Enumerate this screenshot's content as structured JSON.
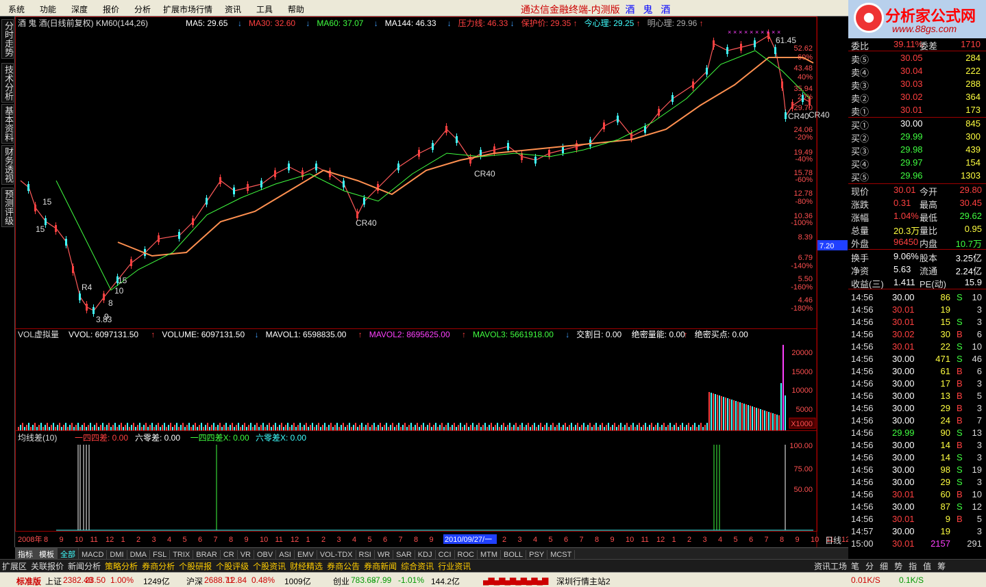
{
  "menu": [
    "系统",
    "功能",
    "深度",
    "报价",
    "分析",
    "扩展市场行情",
    "资讯",
    "工具",
    "帮助"
  ],
  "app_title": "通达信金融终端-内测版",
  "stock_title": "酒 鬼 酒",
  "logo": {
    "text": "分析家公式网",
    "url": "www.88gs.com"
  },
  "side_tabs": [
    "分时走势",
    "技术分析",
    "基本资料",
    "财务透视",
    "预测评级"
  ],
  "main_header": {
    "name": "酒 鬼 酒(日线前复权) KM60(144,26)",
    "items": [
      {
        "label": "MA5: 29.65",
        "color": "#ffffff",
        "arrow": "↓"
      },
      {
        "label": "MA30: 32.60",
        "color": "#ff4040",
        "arrow": "↓"
      },
      {
        "label": "MA60: 37.07",
        "color": "#40ff40",
        "arrow": "↓"
      },
      {
        "label": "MA144: 46.33",
        "color": "#ffffff",
        "arrow": "↓"
      },
      {
        "label": "压力线: 46.33",
        "color": "#ff4040",
        "arrow": "↓"
      },
      {
        "label": "保护价: 29.35",
        "color": "#ff4040",
        "arrow": "↑"
      },
      {
        "label": "今心理: 29.25",
        "color": "#40ffff",
        "arrow": "↑"
      },
      {
        "label": "明心理: 29.96",
        "color": "#aaaaaa",
        "arrow": "↑"
      }
    ]
  },
  "price_axis": [
    "52.62",
    "60%",
    "43.48",
    "40%",
    "35.94",
    "20%",
    "29.70",
    "24.06",
    "-20%",
    "19.49",
    "-40%",
    "15.78",
    "-60%",
    "12.78",
    "-80%",
    "10.36",
    "-100%",
    "8.39",
    "7.20",
    "6.79",
    "-140%",
    "5.50",
    "-160%",
    "4.46",
    "-180%"
  ],
  "price_annotations": [
    "61.45",
    "CR40",
    "CR40",
    "CR40",
    "CR40",
    "3.83",
    "10",
    "15",
    "15",
    "15",
    "R4",
    "8",
    "9"
  ],
  "vol_header": {
    "name": "VOL虚拟量",
    "items": [
      {
        "label": "VVOL: 6097131.50",
        "color": "#ffffff",
        "arrow": "↑"
      },
      {
        "label": "VOLUME: 6097131.50",
        "color": "#ffffff",
        "arrow": "↓"
      },
      {
        "label": "MAVOL1: 6598835.00",
        "color": "#ffffff",
        "arrow": "↑"
      },
      {
        "label": "MAVOL2: 8695625.00",
        "color": "#ff40ff",
        "arrow": "↑"
      },
      {
        "label": "MAVOL3: 5661918.00",
        "color": "#40ff40",
        "arrow": "↓"
      },
      {
        "label": "交割日: 0.00",
        "color": "#ffffff",
        "arrow": ""
      },
      {
        "label": "绝密量能: 0.00",
        "color": "#ffffff",
        "arrow": "↑"
      },
      {
        "label": "绝密买点: 0.00",
        "color": "#ffffff",
        "arrow": ""
      }
    ]
  },
  "vol_axis": [
    "20000",
    "15000",
    "10000",
    "5000",
    "X1000"
  ],
  "ind_header": {
    "name": "均线差(10)",
    "items": [
      {
        "label": "一四四差: 0.00",
        "color": "#ff4040"
      },
      {
        "label": "六零差: 0.00",
        "color": "#ffffff"
      },
      {
        "label": "一四四差X: 0.00",
        "color": "#40ff40"
      },
      {
        "label": "六零差X: 0.00",
        "color": "#40ffff"
      }
    ]
  },
  "ind_axis": [
    "100.00",
    "75.00",
    "50.00"
  ],
  "date_axis": [
    "2008年",
    "8",
    "9",
    "10",
    "11",
    "12",
    "1",
    "2",
    "3",
    "4",
    "5",
    "6",
    "7",
    "8",
    "9",
    "10",
    "11",
    "12",
    "1",
    "2",
    "3",
    "4",
    "5",
    "6",
    "7",
    "8",
    "9",
    "2010/09/27/一",
    "2",
    "3",
    "4",
    "5",
    "6",
    "7",
    "8",
    "9",
    "10",
    "11",
    "12",
    "1",
    "2",
    "3",
    "4",
    "5",
    "6",
    "7",
    "8",
    "9",
    "10",
    "11",
    "12",
    "1"
  ],
  "period_label": "日线",
  "quote": {
    "weibi": {
      "label": "委比",
      "value": "39.11%",
      "label2": "委差",
      "value2": "1710"
    },
    "sells": [
      {
        "label": "卖⑤",
        "price": "30.05",
        "vol": "284"
      },
      {
        "label": "卖④",
        "price": "30.04",
        "vol": "222"
      },
      {
        "label": "卖③",
        "price": "30.03",
        "vol": "288"
      },
      {
        "label": "卖②",
        "price": "30.02",
        "vol": "364"
      },
      {
        "label": "卖①",
        "price": "30.01",
        "vol": "173"
      }
    ],
    "buys": [
      {
        "label": "买①",
        "price": "30.00",
        "vol": "845"
      },
      {
        "label": "买②",
        "price": "29.99",
        "vol": "300"
      },
      {
        "label": "买③",
        "price": "29.98",
        "vol": "439"
      },
      {
        "label": "买④",
        "price": "29.97",
        "vol": "154"
      },
      {
        "label": "买⑤",
        "price": "29.96",
        "vol": "1303"
      }
    ],
    "stats": [
      {
        "l1": "现价",
        "v1": "30.01",
        "c1": "#ff4040",
        "l2": "今开",
        "v2": "29.80",
        "c2": "#ff4040"
      },
      {
        "l1": "涨跌",
        "v1": "0.31",
        "c1": "#ff4040",
        "l2": "最高",
        "v2": "30.45",
        "c2": "#ff4040"
      },
      {
        "l1": "涨幅",
        "v1": "1.04%",
        "c1": "#ff4040",
        "l2": "最低",
        "v2": "29.62",
        "c2": "#40ff40"
      },
      {
        "l1": "总量",
        "v1": "20.3万",
        "c1": "#ffff40",
        "l2": "量比",
        "v2": "0.95",
        "c2": "#ffff40"
      },
      {
        "l1": "外盘",
        "v1": "96450",
        "c1": "#ff4040",
        "l2": "内盘",
        "v2": "10.7万",
        "c2": "#40ff40"
      }
    ],
    "stats2": [
      {
        "l1": "换手",
        "v1": "9.06%",
        "l2": "股本",
        "v2": "3.25亿"
      },
      {
        "l1": "净资",
        "v1": "5.63",
        "l2": "流通",
        "v2": "2.24亿"
      },
      {
        "l1": "收益(三)",
        "v1": "1.411",
        "l2": "PE(动)",
        "v2": "15.9"
      }
    ],
    "ticks": [
      {
        "t": "14:56",
        "p": "30.00",
        "v": "86",
        "s": "S",
        "n": "10"
      },
      {
        "t": "14:56",
        "p": "30.01",
        "v": "19",
        "s": "",
        "n": "3"
      },
      {
        "t": "14:56",
        "p": "30.01",
        "v": "15",
        "s": "S",
        "n": "3"
      },
      {
        "t": "14:56",
        "p": "30.02",
        "v": "30",
        "s": "B",
        "n": "6"
      },
      {
        "t": "14:56",
        "p": "30.01",
        "v": "22",
        "s": "S",
        "n": "10"
      },
      {
        "t": "14:56",
        "p": "30.00",
        "v": "471",
        "s": "S",
        "n": "46"
      },
      {
        "t": "14:56",
        "p": "30.00",
        "v": "61",
        "s": "B",
        "n": "6"
      },
      {
        "t": "14:56",
        "p": "30.00",
        "v": "17",
        "s": "B",
        "n": "3"
      },
      {
        "t": "14:56",
        "p": "30.00",
        "v": "13",
        "s": "B",
        "n": "5"
      },
      {
        "t": "14:56",
        "p": "30.00",
        "v": "29",
        "s": "B",
        "n": "3"
      },
      {
        "t": "14:56",
        "p": "30.00",
        "v": "24",
        "s": "B",
        "n": "7"
      },
      {
        "t": "14:56",
        "p": "29.99",
        "v": "90",
        "s": "S",
        "n": "13"
      },
      {
        "t": "14:56",
        "p": "30.00",
        "v": "14",
        "s": "B",
        "n": "3"
      },
      {
        "t": "14:56",
        "p": "30.00",
        "v": "14",
        "s": "S",
        "n": "3"
      },
      {
        "t": "14:56",
        "p": "30.00",
        "v": "98",
        "s": "S",
        "n": "19"
      },
      {
        "t": "14:56",
        "p": "30.00",
        "v": "29",
        "s": "S",
        "n": "3"
      },
      {
        "t": "14:56",
        "p": "30.01",
        "v": "60",
        "s": "B",
        "n": "10"
      },
      {
        "t": "14:56",
        "p": "30.00",
        "v": "87",
        "s": "S",
        "n": "12"
      },
      {
        "t": "14:56",
        "p": "30.01",
        "v": "9",
        "s": "B",
        "n": "5"
      },
      {
        "t": "14:57",
        "p": "30.00",
        "v": "19",
        "s": "",
        "n": "3"
      },
      {
        "t": "15:00",
        "p": "30.01",
        "v": "2157",
        "s": "",
        "n": "291"
      }
    ]
  },
  "indicator_tabs": [
    "指标",
    "模板",
    "全部",
    "MACD",
    "DMI",
    "DMA",
    "FSL",
    "TRIX",
    "BRAR",
    "CR",
    "VR",
    "OBV",
    "ASI",
    "EMV",
    "VOL-TDX",
    "RSI",
    "WR",
    "SAR",
    "KDJ",
    "CCI",
    "ROC",
    "MTM",
    "BOLL",
    "PSY",
    "MCST"
  ],
  "func_tabs": [
    "扩展区",
    "关联报价",
    "新闻分析",
    "策略分析",
    "券商分析",
    "个股研报",
    "个股评级",
    "个股资讯",
    "财经精选",
    "券商公告",
    "券商新闻",
    "综合资讯",
    "行业资讯"
  ],
  "right_func": [
    "资讯工场",
    "笔",
    "分",
    "细",
    "势",
    "指",
    "值",
    "筹"
  ],
  "status": {
    "brand": "标准版",
    "sh": {
      "label": "上证",
      "val": "2382.48",
      "chg": "23.50",
      "pct": "1.00%",
      "amt": "1249亿"
    },
    "hs": {
      "label": "沪深",
      "val": "2688.71",
      "chg": "12.84",
      "pct": "0.48%",
      "amt": "1009亿"
    },
    "cy": {
      "label": "创业",
      "val": "783.68",
      "chg": "-7.99",
      "pct": "-1.01%",
      "amt": "144.2亿"
    },
    "server": "深圳行情主站2",
    "speed1": "0.01K/S",
    "speed2": "0.1K/S"
  },
  "colors": {
    "up": "#ff4040",
    "down": "#40ff40",
    "flat": "#ffffff",
    "axis": "#b00000"
  }
}
